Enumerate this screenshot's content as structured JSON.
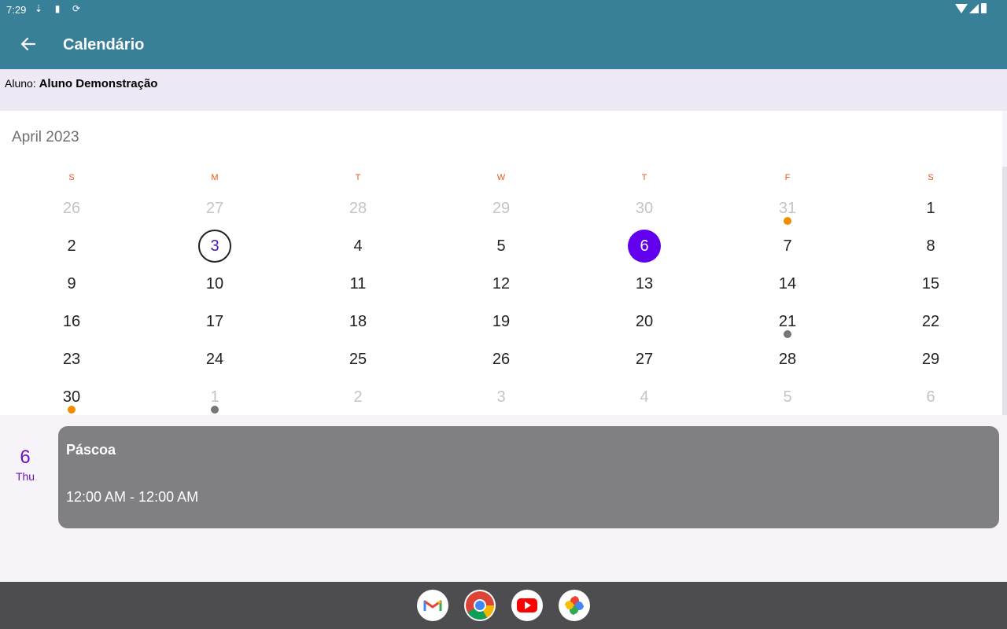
{
  "status_bar": {
    "time": "7:29"
  },
  "app_bar": {
    "title": "Calendário"
  },
  "student": {
    "label": "Aluno:",
    "name": "Aluno Demonstração"
  },
  "calendar": {
    "month_label": "April 2023",
    "weekdays": [
      "S",
      "M",
      "T",
      "W",
      "T",
      "F",
      "S"
    ],
    "weeks": [
      [
        {
          "d": "26",
          "out": true
        },
        {
          "d": "27",
          "out": true
        },
        {
          "d": "28",
          "out": true
        },
        {
          "d": "29",
          "out": true
        },
        {
          "d": "30",
          "out": true
        },
        {
          "d": "31",
          "out": true,
          "dot": "orange"
        },
        {
          "d": "1"
        }
      ],
      [
        {
          "d": "2"
        },
        {
          "d": "3",
          "today": true
        },
        {
          "d": "4"
        },
        {
          "d": "5"
        },
        {
          "d": "6",
          "selected": true
        },
        {
          "d": "7"
        },
        {
          "d": "8"
        }
      ],
      [
        {
          "d": "9"
        },
        {
          "d": "10"
        },
        {
          "d": "11"
        },
        {
          "d": "12"
        },
        {
          "d": "13"
        },
        {
          "d": "14"
        },
        {
          "d": "15"
        }
      ],
      [
        {
          "d": "16"
        },
        {
          "d": "17"
        },
        {
          "d": "18"
        },
        {
          "d": "19"
        },
        {
          "d": "20"
        },
        {
          "d": "21",
          "dot": "gray"
        },
        {
          "d": "22"
        }
      ],
      [
        {
          "d": "23"
        },
        {
          "d": "24"
        },
        {
          "d": "25"
        },
        {
          "d": "26"
        },
        {
          "d": "27"
        },
        {
          "d": "28"
        },
        {
          "d": "29"
        }
      ],
      [
        {
          "d": "30",
          "dot": "orange"
        },
        {
          "d": "1",
          "out": true,
          "dot": "gray"
        },
        {
          "d": "2",
          "out": true
        },
        {
          "d": "3",
          "out": true
        },
        {
          "d": "4",
          "out": true
        },
        {
          "d": "5",
          "out": true
        },
        {
          "d": "6",
          "out": true
        }
      ]
    ],
    "dot_colors": {
      "orange": "#f28c00",
      "gray": "#757575"
    }
  },
  "agenda": {
    "day_number": "6",
    "day_name": "Thu",
    "event": {
      "title": "Páscoa",
      "time": "12:00 AM - 12:00 AM"
    }
  },
  "taskbar": {
    "apps": [
      {
        "name": "gmail",
        "icon": "gmail-icon"
      },
      {
        "name": "chrome",
        "icon": "chrome-icon"
      },
      {
        "name": "youtube",
        "icon": "youtube-icon"
      },
      {
        "name": "photos",
        "icon": "photos-icon"
      }
    ]
  },
  "colors": {
    "app_bar": "#387f98",
    "selected_day": "#6200ee",
    "weekday_label": "#e8561b",
    "agenda_date": "#6f0fc9",
    "event_card": "#807f82"
  }
}
